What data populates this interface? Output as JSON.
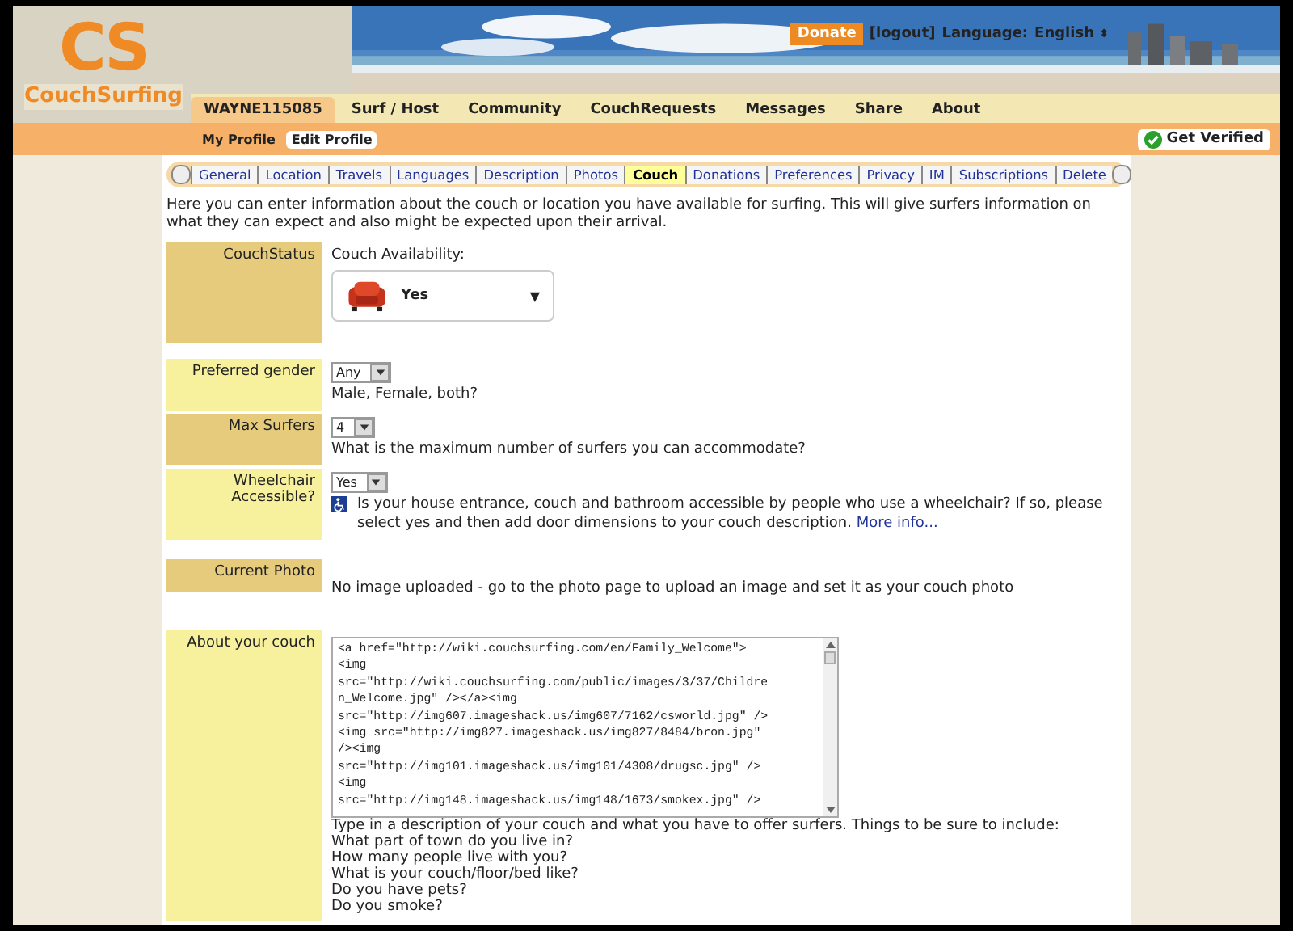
{
  "logo": {
    "letters": "CS",
    "name": "CouchSurfing"
  },
  "top_links": {
    "donate": "Donate",
    "logout": "[logout]",
    "language_label": "Language:",
    "language_value": "English",
    "language_arrow": "⬍"
  },
  "nav": [
    {
      "label": "WAYNE115085",
      "selected": true
    },
    {
      "label": "Surf / Host",
      "selected": false
    },
    {
      "label": "Community",
      "selected": false
    },
    {
      "label": "CouchRequests",
      "selected": false
    },
    {
      "label": "Messages",
      "selected": false
    },
    {
      "label": "Share",
      "selected": false
    },
    {
      "label": "About",
      "selected": false
    }
  ],
  "subnav": [
    {
      "label": "My Profile",
      "selected": false
    },
    {
      "label": "Edit Profile",
      "selected": true
    }
  ],
  "get_verified": "Get Verified",
  "tabs": [
    {
      "label": "General",
      "selected": false
    },
    {
      "label": "Location",
      "selected": false
    },
    {
      "label": "Travels",
      "selected": false
    },
    {
      "label": "Languages",
      "selected": false
    },
    {
      "label": "Description",
      "selected": false
    },
    {
      "label": "Photos",
      "selected": false
    },
    {
      "label": "Couch",
      "selected": true
    },
    {
      "label": "Donations",
      "selected": false
    },
    {
      "label": "Preferences",
      "selected": false
    },
    {
      "label": "Privacy",
      "selected": false
    },
    {
      "label": "IM",
      "selected": false
    },
    {
      "label": "Subscriptions",
      "selected": false
    },
    {
      "label": "Delete",
      "selected": false
    }
  ],
  "intro": "Here you can enter information about the couch or location you have available for surfing. This will give surfers information on what they can expect and also might be expected upon their arrival.",
  "rows": [
    {
      "kind": "couch",
      "label": "CouchStatus",
      "caption": "Couch Availability:",
      "value": "Yes",
      "arrow": "▼"
    },
    {
      "kind": "select",
      "label": "Preferred gender",
      "value": "Any",
      "help": "Male, Female, both?"
    },
    {
      "kind": "select",
      "label": "Max Surfers",
      "value": "4",
      "help": "What is the maximum number of surfers you can accommodate?"
    },
    {
      "kind": "wheelchair",
      "label": "Wheelchair Accessible?",
      "value": "Yes",
      "help": "Is your house entrance, couch and bathroom accessible by people who use a wheelchair? If so, please select yes and then add door dimensions to your couch description.",
      "link": "More info..."
    },
    {
      "kind": "text",
      "label": "Current Photo",
      "help": "No image uploaded - go to the photo page to upload an image and set it as your couch photo"
    },
    {
      "kind": "textarea",
      "label": "About your couch",
      "lines": [
        "<a href=\"http://wiki.couchsurfing.com/en/Family_Welcome\">",
        "<img",
        "src=\"http://wiki.couchsurfing.com/public/images/3/37/Childre",
        "n_Welcome.jpg\" /></a><img",
        "src=\"http://img607.imageshack.us/img607/7162/csworld.jpg\" />",
        "<img src=\"http://img827.imageshack.us/img827/8484/bron.jpg\"",
        "/><img",
        "src=\"http://img101.imageshack.us/img101/4308/drugsc.jpg\" />",
        "<img",
        "src=\"http://img148.imageshack.us/img148/1673/smokex.jpg\" />"
      ],
      "help_lines": [
        "Type in a description of your couch and what you have to offer surfers. Things to be sure to include:",
        "What part of town do you live in?",
        "How many people live with you?",
        "What is your couch/floor/bed like?",
        "Do you have pets?",
        "Do you smoke?"
      ]
    }
  ]
}
